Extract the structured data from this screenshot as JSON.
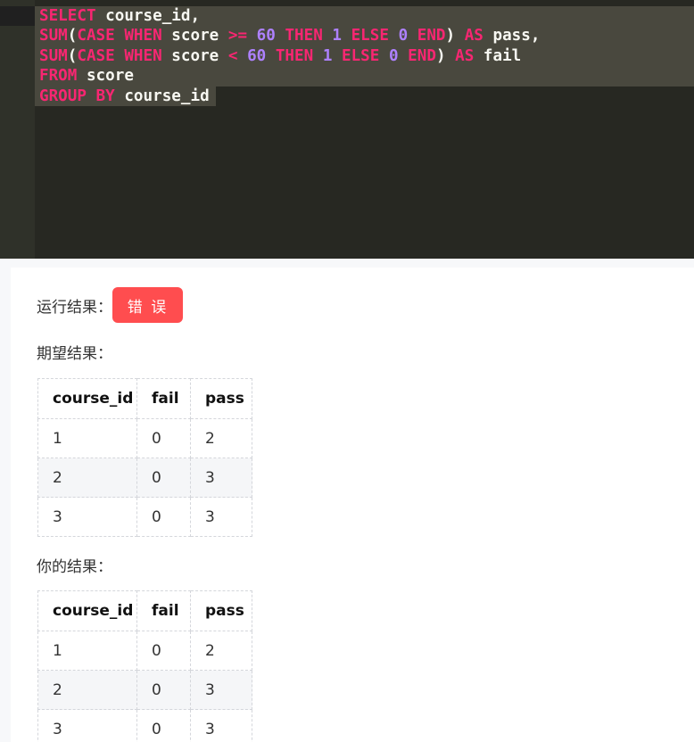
{
  "editor": {
    "lines": [
      [
        {
          "t": "SELECT",
          "c": "kw"
        },
        {
          "t": " course_id,",
          "c": "id"
        }
      ],
      [
        {
          "t": "SUM",
          "c": "kw"
        },
        {
          "t": "(",
          "c": "id"
        },
        {
          "t": "CASE",
          "c": "kw"
        },
        {
          "t": " ",
          "c": "id"
        },
        {
          "t": "WHEN",
          "c": "kw"
        },
        {
          "t": " score ",
          "c": "id"
        },
        {
          "t": ">=",
          "c": "kw"
        },
        {
          "t": " ",
          "c": "id"
        },
        {
          "t": "60",
          "c": "num"
        },
        {
          "t": " ",
          "c": "id"
        },
        {
          "t": "THEN",
          "c": "kw"
        },
        {
          "t": " ",
          "c": "id"
        },
        {
          "t": "1",
          "c": "num"
        },
        {
          "t": " ",
          "c": "id"
        },
        {
          "t": "ELSE",
          "c": "kw"
        },
        {
          "t": " ",
          "c": "id"
        },
        {
          "t": "0",
          "c": "num"
        },
        {
          "t": " ",
          "c": "id"
        },
        {
          "t": "END",
          "c": "kw"
        },
        {
          "t": ") ",
          "c": "id"
        },
        {
          "t": "AS",
          "c": "kw"
        },
        {
          "t": " pass,",
          "c": "id"
        }
      ],
      [
        {
          "t": "SUM",
          "c": "kw"
        },
        {
          "t": "(",
          "c": "id"
        },
        {
          "t": "CASE",
          "c": "kw"
        },
        {
          "t": " ",
          "c": "id"
        },
        {
          "t": "WHEN",
          "c": "kw"
        },
        {
          "t": " score ",
          "c": "id"
        },
        {
          "t": "<",
          "c": "kw"
        },
        {
          "t": " ",
          "c": "id"
        },
        {
          "t": "60",
          "c": "num"
        },
        {
          "t": " ",
          "c": "id"
        },
        {
          "t": "THEN",
          "c": "kw"
        },
        {
          "t": " ",
          "c": "id"
        },
        {
          "t": "1",
          "c": "num"
        },
        {
          "t": " ",
          "c": "id"
        },
        {
          "t": "ELSE",
          "c": "kw"
        },
        {
          "t": " ",
          "c": "id"
        },
        {
          "t": "0",
          "c": "num"
        },
        {
          "t": " ",
          "c": "id"
        },
        {
          "t": "END",
          "c": "kw"
        },
        {
          "t": ") ",
          "c": "id"
        },
        {
          "t": "AS",
          "c": "kw"
        },
        {
          "t": " fail",
          "c": "id"
        }
      ],
      [
        {
          "t": "FROM",
          "c": "kw"
        },
        {
          "t": " score",
          "c": "id"
        }
      ],
      [
        {
          "t": "GROUP BY",
          "c": "kw"
        },
        {
          "t": " course_id",
          "c": "id"
        }
      ]
    ]
  },
  "result": {
    "run_label": "运行结果：",
    "status": "错 误",
    "status_color": "#ff4d4f"
  },
  "expected": {
    "label": "期望结果：",
    "columns": [
      "course_id",
      "fail",
      "pass"
    ],
    "rows": [
      [
        "1",
        "0",
        "2"
      ],
      [
        "2",
        "0",
        "3"
      ],
      [
        "3",
        "0",
        "3"
      ]
    ]
  },
  "actual": {
    "label": "你的结果：",
    "columns": [
      "course_id",
      "fail",
      "pass"
    ],
    "rows": [
      [
        "1",
        "0",
        "2"
      ],
      [
        "2",
        "0",
        "3"
      ],
      [
        "3",
        "0",
        "3"
      ]
    ]
  }
}
